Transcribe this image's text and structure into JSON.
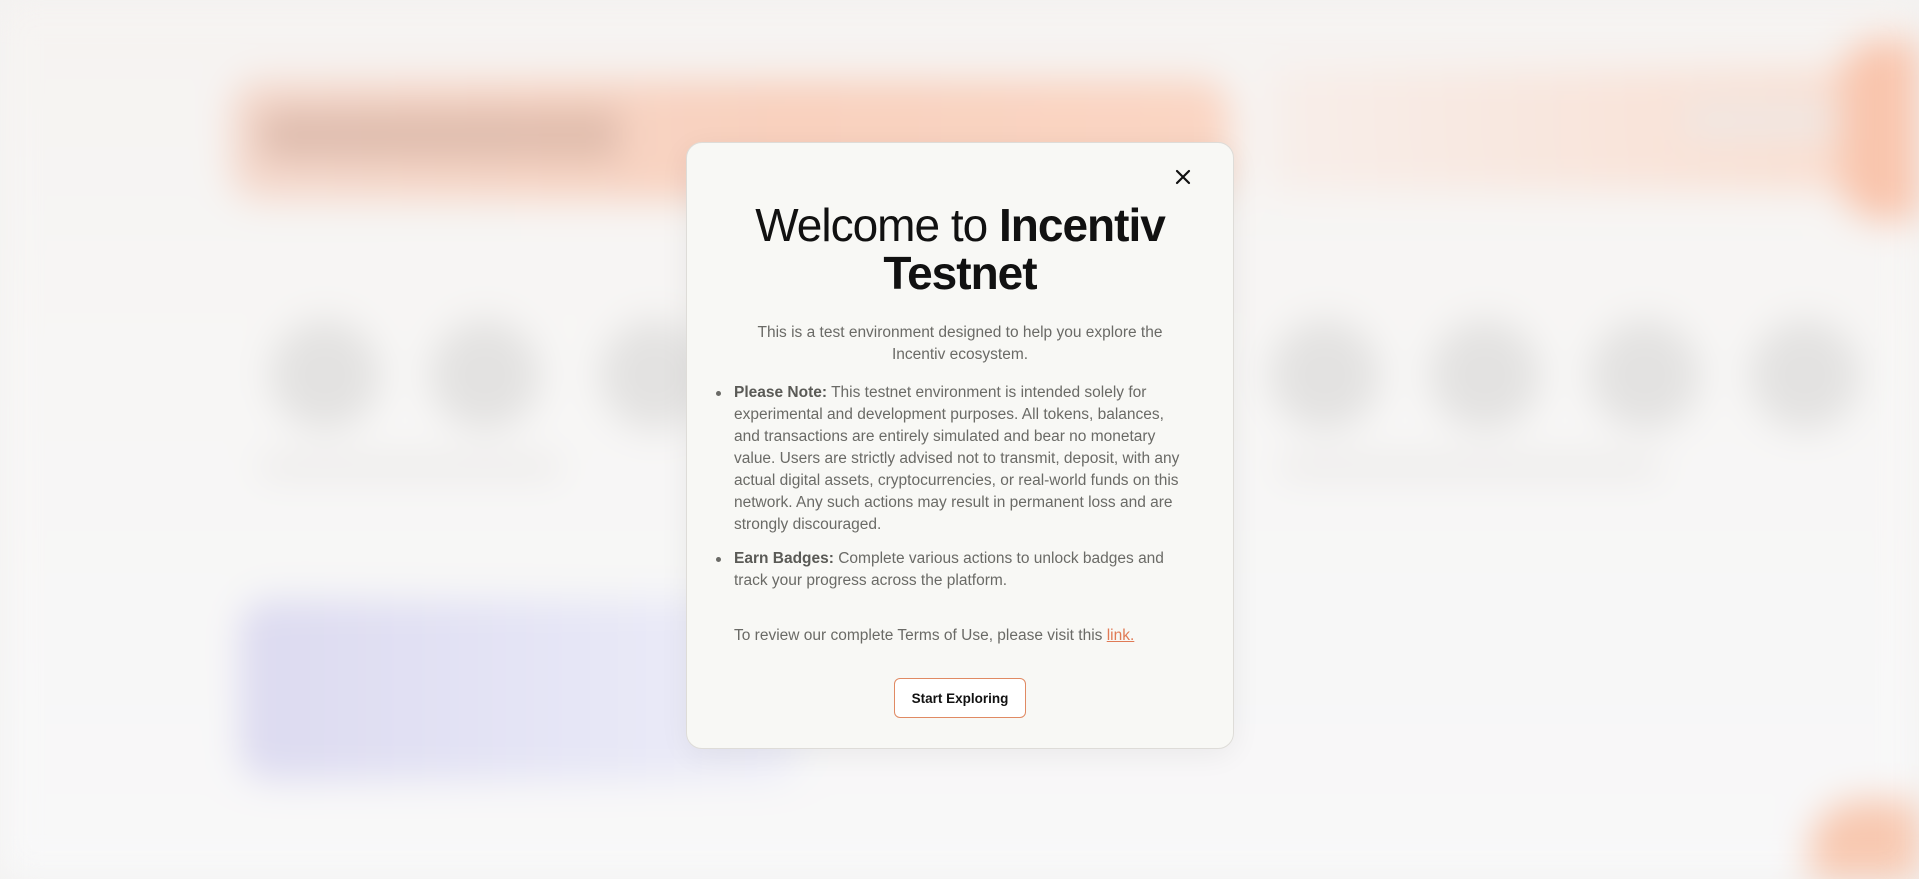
{
  "modal": {
    "close_icon": "close-icon",
    "title_prefix": "Welcome to ",
    "title_brand": "Incentiv",
    "title_line2": "Testnet",
    "intro": "This is a test environment designed to help you explore the Incentiv ecosystem.",
    "notes": [
      {
        "label": "Please Note:",
        "text": " This testnet environment is intended solely for experimental and development purposes. All tokens, balances, and transactions are entirely simulated and bear no monetary value. Users are strictly advised not to transmit, deposit, with any actual digital assets, cryptocurrencies, or real-world funds on this network. Any such actions may result in permanent loss and are strongly discouraged."
      },
      {
        "label": "Earn Badges:",
        "text": " Complete various actions to unlock badges and track your progress across the platform."
      }
    ],
    "terms_text": "To review our complete Terms of Use, please visit this ",
    "terms_link": "link.",
    "cta_label": "Start Exploring"
  },
  "colors": {
    "accent": "#e07a55",
    "modal_bg": "#f8f8f5",
    "text_muted": "#6a6a66"
  }
}
